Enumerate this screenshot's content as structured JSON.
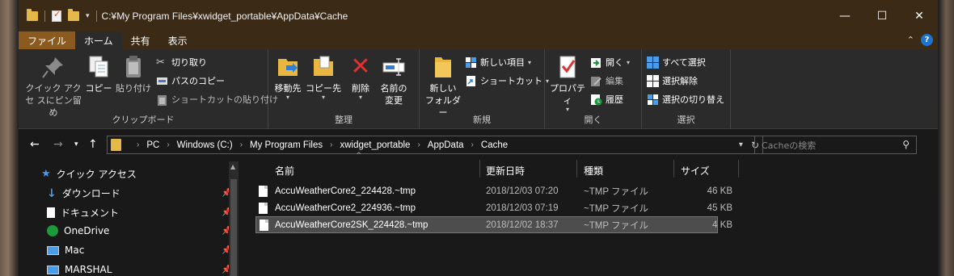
{
  "window": {
    "title_path": "C:¥My Program Files¥xwidget_portable¥AppData¥Cache",
    "controls": {
      "minimize": "—",
      "maximize": "☐",
      "close": "✕"
    }
  },
  "tabs": [
    {
      "label": "ファイル"
    },
    {
      "label": "ホーム"
    },
    {
      "label": "共有"
    },
    {
      "label": "表示"
    }
  ],
  "help_label": "?",
  "ribbon": {
    "clipboard": {
      "title": "クリップボード",
      "pin_quick_access": "クイック アクセ スにピン留め",
      "copy": "コピー",
      "paste": "貼り付け",
      "cut": "切り取り",
      "copy_path": "パスのコピー",
      "paste_shortcut": "ショートカットの貼り付け"
    },
    "organize": {
      "title": "整理",
      "move_to": "移動先",
      "copy_to": "コピー先",
      "delete": "削除",
      "rename_line1": "名前の",
      "rename_line2": "変更"
    },
    "new": {
      "title": "新規",
      "new_folder_line1": "新しい",
      "new_folder_line2": "フォルダー",
      "new_item": "新しい項目",
      "shortcut": "ショートカット"
    },
    "open": {
      "title": "開く",
      "properties": "プロパティ",
      "open": "開く",
      "edit": "編集",
      "history": "履歴"
    },
    "select": {
      "title": "選択",
      "select_all": "すべて選択",
      "select_none": "選択解除",
      "invert": "選択の切り替え"
    }
  },
  "address": {
    "crumbs": [
      "PC",
      "Windows (C:)",
      "My Program Files",
      "xwidget_portable",
      "AppData",
      "Cache"
    ],
    "search_placeholder": "Cacheの検索"
  },
  "nav_items": [
    {
      "label": "クイック アクセス",
      "icon": "star-icon"
    },
    {
      "label": "ダウンロード",
      "icon": "download-icon",
      "pinned": true
    },
    {
      "label": "ドキュメント",
      "icon": "document-icon",
      "pinned": true
    },
    {
      "label": "OneDrive",
      "icon": "cloud-icon",
      "pinned": true
    },
    {
      "label": "Mac",
      "icon": "monitor-icon",
      "pinned": true
    },
    {
      "label": "MARSHAL",
      "icon": "monitor-icon",
      "pinned": true
    }
  ],
  "columns": {
    "name": "名前",
    "date": "更新日時",
    "type": "種類",
    "size": "サイズ"
  },
  "files": [
    {
      "name": "AccuWeatherCore2_224428.~tmp",
      "date": "2018/12/03 07:20",
      "type": "~TMP ファイル",
      "size": "46 KB",
      "selected": false
    },
    {
      "name": "AccuWeatherCore2_224936.~tmp",
      "date": "2018/12/03 07:19",
      "type": "~TMP ファイル",
      "size": "45 KB",
      "selected": false
    },
    {
      "name": "AccuWeatherCore2SK_224428.~tmp",
      "date": "2018/12/02 18:37",
      "type": "~TMP ファイル",
      "size": "4 KB",
      "selected": true
    }
  ],
  "colors": {
    "titlebar": "#3b2a16",
    "file_tab": "#8b5a1e",
    "ribbon": "#2b2b2b",
    "background": "#191919",
    "selection": "#4d4d4d"
  }
}
